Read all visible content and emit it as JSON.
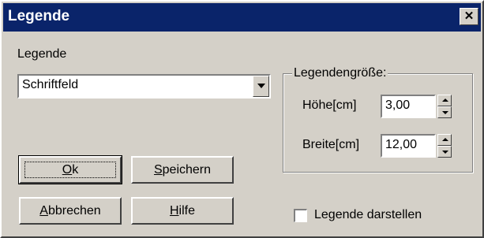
{
  "window": {
    "title": "Legende",
    "close_symbol": "✕"
  },
  "legend_label": "Legende",
  "legend_select": {
    "value": "Schriftfeld"
  },
  "size_group": {
    "title": "Legendengröße:",
    "height_label": "Höhe[cm]",
    "height_value": "3,00",
    "width_label": "Breite[cm]",
    "width_value": "12,00"
  },
  "buttons": {
    "ok": {
      "mnemonic": "O",
      "rest": "k"
    },
    "save": {
      "mnemonic": "S",
      "rest": "peichern"
    },
    "cancel": {
      "mnemonic": "A",
      "rest": "bbrechen"
    },
    "help": {
      "mnemonic": "H",
      "rest": "ilfe"
    }
  },
  "show_legend": {
    "label": "Legende darstellen",
    "checked": false
  }
}
